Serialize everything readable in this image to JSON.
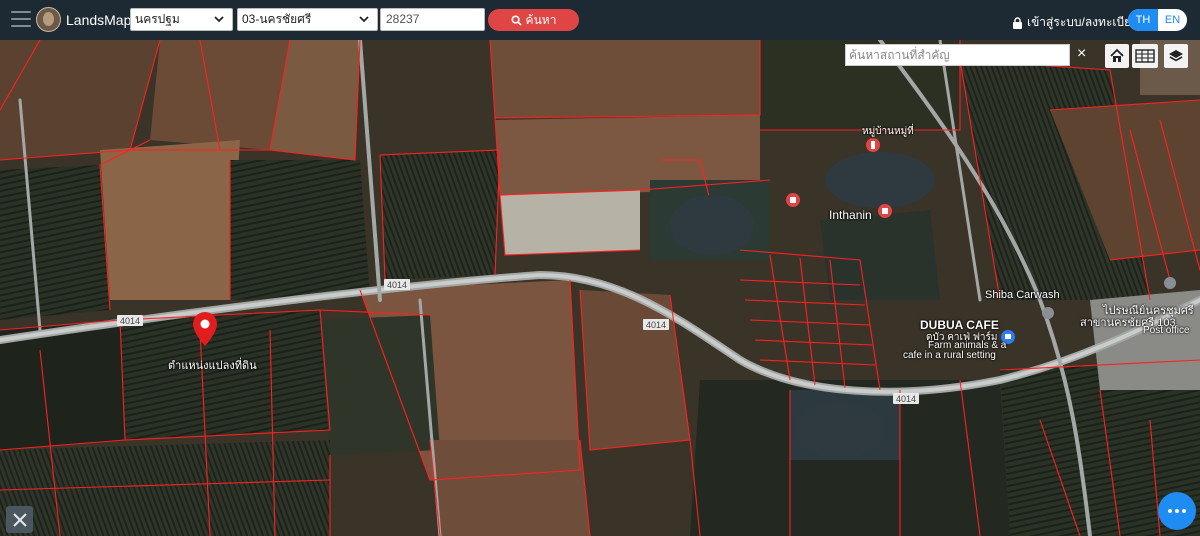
{
  "header": {
    "app_name": "LandsMaps",
    "province": "นครปฐม",
    "district": "03-นครชัยศรี",
    "deed_number": "28237",
    "search_label": "ค้นหา",
    "login_label": "เข้าสู่ระบบ/ลงทะเบียน",
    "lang_th": "TH",
    "lang_en": "EN"
  },
  "map_tools": {
    "place_search_placeholder": "ค้นหาสถานที่สำคัญ",
    "close_symbol": "×"
  },
  "map": {
    "marker_label": "ตำแหน่งแปลงที่ดิน",
    "road_labels": [
      "4014",
      "4014",
      "4014",
      "4014"
    ],
    "places": {
      "inthanin": "Inthanin",
      "shiba": "Shiba Carwash",
      "dubua_title": "DUBUA CAFE",
      "dubua_thai": "ดูบัว คาเฟ่ ฟาร์ม",
      "dubua_desc1": "Farm animals & a",
      "dubua_desc2": "cafe in a rural setting",
      "market": "หมู่บ้านหมู่ที่",
      "post_thai1": "ไปรษณีย์นครชุมศรี",
      "post_thai2": "สาขานครชัยศรี 103",
      "post_office": "Post office"
    }
  },
  "colors": {
    "topbar": "#1e2a33",
    "accent_red": "#e04545",
    "accent_blue": "#1e8cf0",
    "parcel_line": "#ff2020"
  }
}
